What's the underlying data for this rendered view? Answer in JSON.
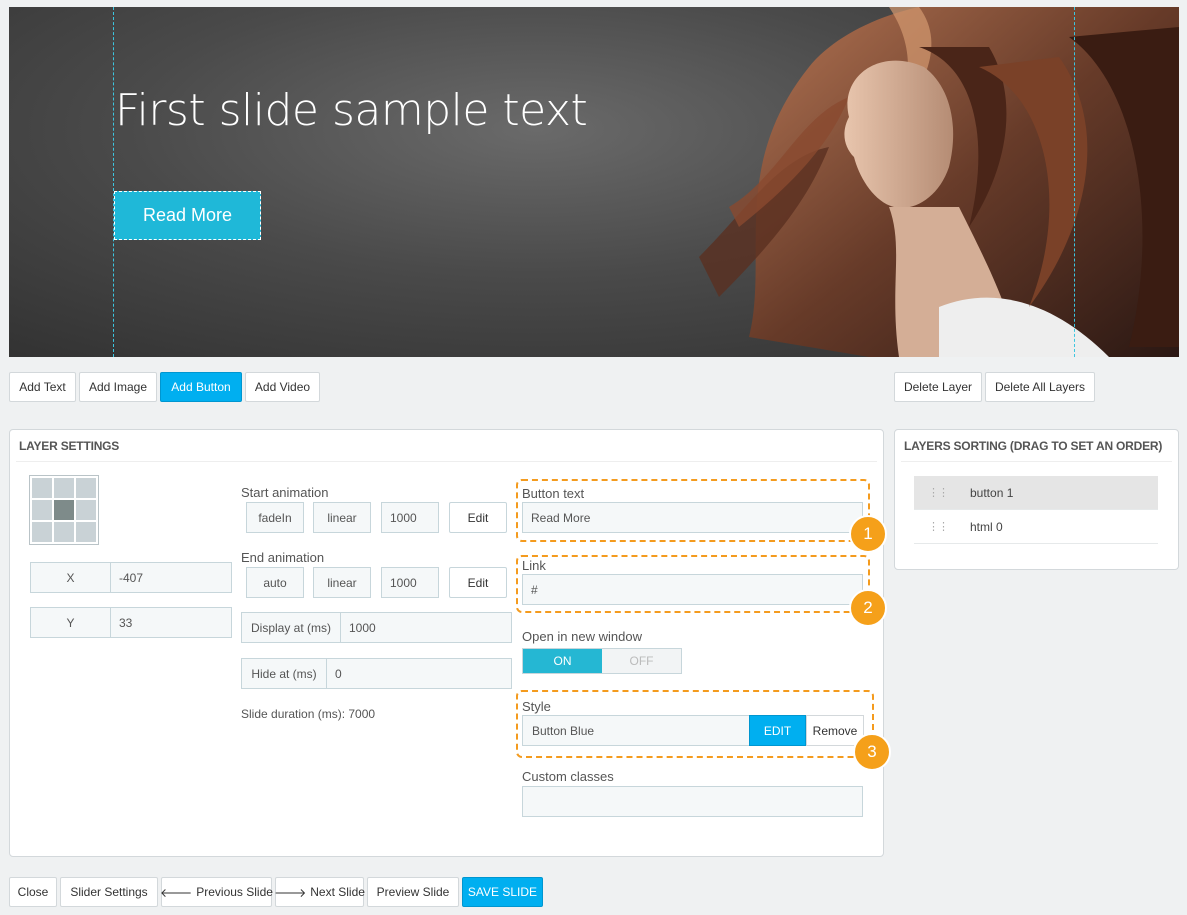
{
  "preview": {
    "title": "First slide sample text",
    "button_text": "Read More"
  },
  "layer_toolbar": {
    "add_text": "Add Text",
    "add_image": "Add Image",
    "add_button": "Add Button",
    "add_video": "Add Video",
    "delete_layer": "Delete Layer",
    "delete_all_layers": "Delete All Layers"
  },
  "layer_settings": {
    "heading": "LAYER SETTINGS",
    "x_label": "X",
    "x_value": "-407",
    "y_label": "Y",
    "y_value": "33",
    "start_animation": {
      "label": "Start animation",
      "effect": "fadeIn",
      "easing": "linear",
      "duration": "1000",
      "edit": "Edit"
    },
    "end_animation": {
      "label": "End animation",
      "effect": "auto",
      "easing": "linear",
      "duration": "1000",
      "edit": "Edit"
    },
    "display_at": {
      "label": "Display at (ms)",
      "value": "1000"
    },
    "hide_at": {
      "label": "Hide at (ms)",
      "value": "0"
    },
    "slide_duration": "Slide duration (ms): 7000",
    "button_text": {
      "label": "Button text",
      "value": "Read More"
    },
    "link": {
      "label": "Link",
      "value": "#"
    },
    "open_new_window": {
      "label": "Open in new window",
      "on": "ON",
      "off": "OFF",
      "state": "on"
    },
    "style": {
      "label": "Style",
      "value": "Button Blue",
      "edit": "EDIT",
      "remove": "Remove"
    },
    "custom_classes": {
      "label": "Custom classes",
      "value": ""
    },
    "callouts": [
      "1",
      "2",
      "3"
    ]
  },
  "layers_sorting": {
    "heading": "LAYERS SORTING (DRAG TO SET AN ORDER)",
    "items": [
      {
        "name": "button 1",
        "active": true
      },
      {
        "name": "html 0",
        "active": false
      }
    ]
  },
  "footer": {
    "close": "Close",
    "slider_settings": "Slider Settings",
    "previous_slide": "Previous Slide",
    "next_slide": "Next Slide",
    "preview_slide": "Preview Slide",
    "save_slide": "SAVE SLIDE"
  },
  "colors": {
    "accent": "#00aff0",
    "highlight": "#f49b1e",
    "toggle_on": "#25b7d3"
  }
}
